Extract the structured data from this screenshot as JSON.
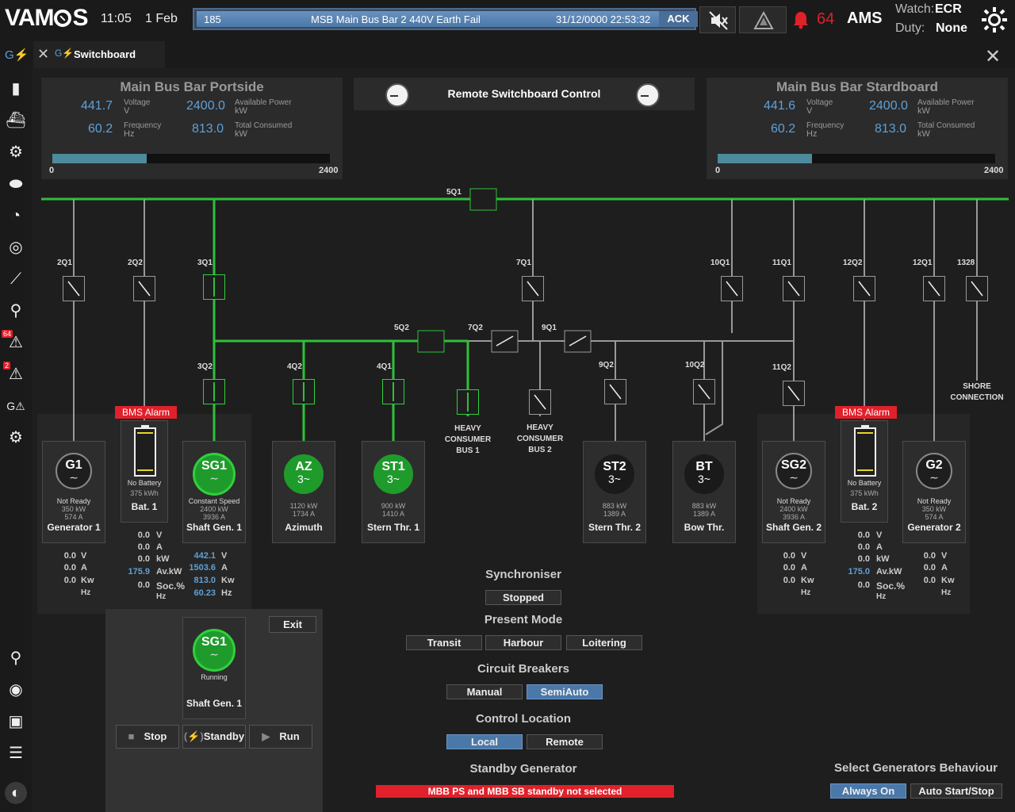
{
  "topbar": {
    "logo": "VAM S",
    "time": "11:05",
    "date": "1 Feb",
    "alarm_id": "185",
    "alarm_text": "MSB Main Bus Bar 2 440V Earth Fail",
    "alarm_time": "31/12/0000 22:53:32",
    "ack_label": "ACK",
    "alarm_count": "64",
    "ams_label": "AMS",
    "watch_label": "Watch:",
    "watch_value": "ECR",
    "duty_label": "Duty:",
    "duty_value": "None",
    "icons": [
      "mute-icon",
      "warning-icon",
      "bell-icon",
      "day-night-icon"
    ]
  },
  "sidebar": {
    "items": [
      "power-icon",
      "battery-icon",
      "ship-icon",
      "engine-icon",
      "tank-icon",
      "fuel-icon",
      "pump-icon",
      "trend-icon",
      "network-icon",
      "alarm-list-icon",
      "alarm-list-2-icon",
      "power-alarm-icon",
      "settings-icon"
    ],
    "badge_1": "64",
    "badge_2": "2",
    "bottom_items": [
      "zoom-icon",
      "eye-icon",
      "camera-icon",
      "menu-icon",
      "lock-icon"
    ]
  },
  "tab": {
    "label": "Switchboard"
  },
  "portside": {
    "title": "Main Bus Bar Portside",
    "voltage": "441.7",
    "voltage_label": "Voltage",
    "voltage_unit": "V",
    "frequency": "60.2",
    "frequency_label": "Frequency",
    "frequency_unit": "Hz",
    "available_power": "2400.0",
    "available_power_label": "Available Power",
    "available_power_unit": "kW",
    "total_consumed": "813.0",
    "total_consumed_label": "Total Consumed",
    "total_consumed_unit": "kW",
    "scale_min": "0",
    "scale_max": "2400",
    "load_fraction": 0.339
  },
  "starboard": {
    "title": "Main Bus Bar Stardboard",
    "voltage": "441.6",
    "voltage_label": "Voltage",
    "voltage_unit": "V",
    "frequency": "60.2",
    "frequency_label": "Frequency",
    "frequency_unit": "Hz",
    "available_power": "2400.0",
    "available_power_label": "Available Power",
    "available_power_unit": "kW",
    "total_consumed": "813.0",
    "total_consumed_label": "Total Consumed",
    "total_consumed_unit": "kW",
    "scale_min": "0",
    "scale_max": "2400",
    "load_fraction": 0.339
  },
  "remote_control": {
    "label": "Remote Switchboard Control"
  },
  "breakers": [
    "5Q1",
    "2Q1",
    "2Q2",
    "3Q1",
    "7Q1",
    "10Q1",
    "11Q1",
    "12Q2",
    "12Q1",
    "1328",
    "5Q2",
    "7Q2",
    "9Q1",
    "3Q2",
    "4Q2",
    "4Q1",
    "9Q2",
    "10Q2",
    "11Q2"
  ],
  "consumer_labels": {
    "heavy1": [
      "HEAVY",
      "CONSUMER",
      "BUS 1"
    ],
    "heavy2": [
      "HEAVY",
      "CONSUMER",
      "BUS 2"
    ],
    "shore": [
      "SHORE",
      "CONNECTION"
    ]
  },
  "bms_alarm": "BMS Alarm",
  "units": {
    "v": "V",
    "a": "A",
    "kw": "kW",
    "kw2": "Kw",
    "hz": "Hz",
    "avkw": "Av.kW",
    "soc": "Soc.%"
  },
  "units_list": [
    "V",
    "A",
    "Kw",
    "Hz"
  ],
  "bat_units_list": [
    "V",
    "A",
    "kW",
    "Av.kW",
    "Soc.%",
    "Hz"
  ],
  "g1": {
    "tag": "G1",
    "status": "Not Ready",
    "kw": "350 kW",
    "amp": "574 A",
    "name": "Generator 1",
    "vals": [
      "0.0",
      "0.0",
      "0.0",
      ""
    ]
  },
  "bat1": {
    "status": "No Battery",
    "kwh": "375 kWh",
    "name": "Bat. 1",
    "vals": [
      "0.0",
      "0.0",
      "0.0",
      "175.9",
      "0.0",
      ""
    ]
  },
  "sg1": {
    "tag": "SG1",
    "status": "Constant Speed",
    "kw": "2400 kW",
    "amp": "3936 A",
    "name": "Shaft Gen. 1",
    "vals": [
      "442.1",
      "1503.6",
      "813.0",
      "60.23"
    ]
  },
  "az": {
    "tag": "AZ",
    "phase": "3~",
    "kw": "1120 kW",
    "amp": "1734 A",
    "name": "Azimuth"
  },
  "st1": {
    "tag": "ST1",
    "phase": "3~",
    "kw": "900 kW",
    "amp": "1410 A",
    "name": "Stern Thr. 1"
  },
  "st2": {
    "tag": "ST2",
    "phase": "3~",
    "kw": "883 kW",
    "amp": "1389 A",
    "name": "Stern Thr. 2"
  },
  "bt": {
    "tag": "BT",
    "phase": "3~",
    "kw": "883 kW",
    "amp": "1389 A",
    "name": "Bow Thr."
  },
  "sg2": {
    "tag": "SG2",
    "status": "Not Ready",
    "kw": "2400 kW",
    "amp": "3936 A",
    "name": "Shaft Gen. 2",
    "vals": [
      "0.0",
      "0.0",
      "0.0",
      ""
    ]
  },
  "bat2": {
    "status": "No Battery",
    "kwh": "375 kWh",
    "name": "Bat. 2",
    "vals": [
      "0.0",
      "0.0",
      "0.0",
      "175.0",
      "0.0",
      ""
    ]
  },
  "g2": {
    "tag": "G2",
    "status": "Not Ready",
    "kw": "350 kW",
    "amp": "574 A",
    "name": "Generator 2",
    "vals": [
      "0.0",
      "0.0",
      "0.0",
      ""
    ]
  },
  "control_popup": {
    "exit_label": "Exit",
    "tag": "SG1",
    "status": "Running",
    "name": "Shaft Gen. 1",
    "stop_label": "Stop",
    "standby_label": "Standby",
    "run_label": "Run"
  },
  "synchroniser": {
    "title": "Synchroniser",
    "state": "Stopped"
  },
  "present_mode": {
    "title": "Present Mode",
    "options": [
      "Transit",
      "Harbour",
      "Loitering"
    ]
  },
  "circuit_breakers": {
    "title": "Circuit Breakers",
    "options": [
      "Manual",
      "SemiAuto"
    ],
    "active": "SemiAuto"
  },
  "control_location": {
    "title": "Control Location",
    "options": [
      "Local",
      "Remote"
    ],
    "active": "Local"
  },
  "standby_generator": {
    "title": "Standby Generator",
    "message": "MBB PS and MBB SB standby not selected"
  },
  "generator_behaviour": {
    "title": "Select Generators Behaviour",
    "options": [
      "Always On",
      "Auto Start/Stop"
    ],
    "active": "Always On"
  },
  "colors": {
    "bus_green": "#2fc03a",
    "accent_blue": "#5ea0d8",
    "alarm_red": "#e0202a",
    "active_button": "#4a78a8"
  }
}
